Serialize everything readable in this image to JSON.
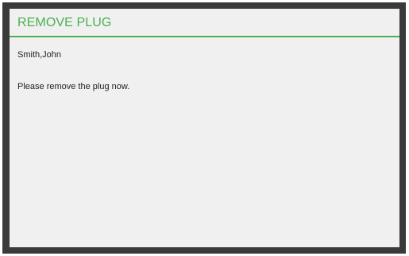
{
  "dialog": {
    "title": "REMOVE PLUG",
    "customer_name": "Smith,John",
    "message": "Please remove the plug now."
  },
  "colors": {
    "accent": "#4caf50",
    "bezel": "#3a3a3a",
    "screen_background": "#f0f0f0",
    "text": "#222222"
  }
}
